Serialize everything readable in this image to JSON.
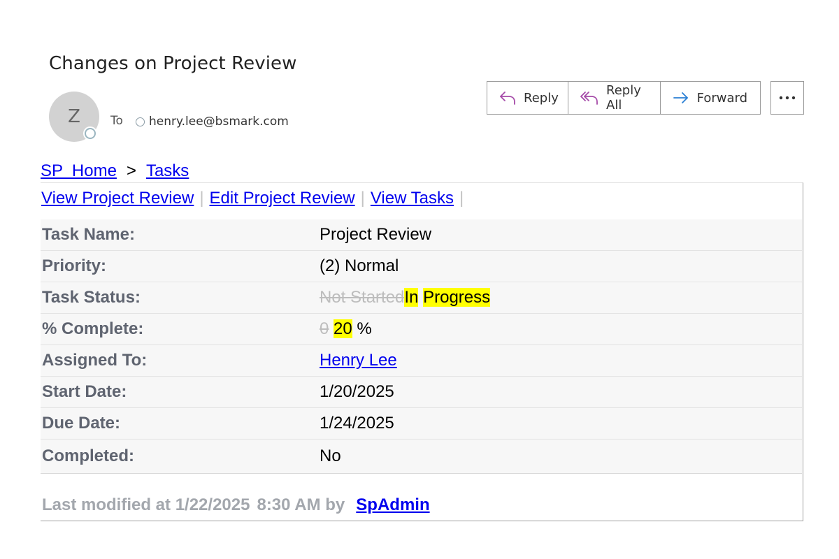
{
  "email": {
    "subject": "Changes on Project Review",
    "avatar_initial": "Z",
    "to_label": "To",
    "recipient": "henry.lee@bsmark.com",
    "actions": {
      "reply": "Reply",
      "reply_all": "Reply All",
      "forward": "Forward"
    }
  },
  "breadcrumb": {
    "home": "SP  Home",
    "separator": ">",
    "current": "Tasks"
  },
  "toolbar": {
    "view_item": "View Project Review",
    "edit_item": "Edit Project Review",
    "view_list": "View Tasks",
    "separator": "|"
  },
  "fields": {
    "task_name": {
      "label": "Task Name:",
      "value": "Project Review"
    },
    "priority": {
      "label": "Priority:",
      "value": "(2) Normal"
    },
    "task_status": {
      "label": "Task Status:",
      "old_value": "Not Started",
      "new_word1": "In",
      "new_word2": "Progress"
    },
    "percent_complete": {
      "label": "% Complete:",
      "old_value": "0",
      "new_value": "20",
      "unit": "%"
    },
    "assigned_to": {
      "label": "Assigned To:",
      "value": "Henry Lee"
    },
    "start_date": {
      "label": "Start Date:",
      "value": "1/20/2025"
    },
    "due_date": {
      "label": "Due Date:",
      "value": "1/24/2025"
    },
    "completed": {
      "label": "Completed:",
      "value": "No"
    }
  },
  "footer": {
    "prefix": "Last modified at 1/22/2025",
    "time": "8:30 AM by",
    "user": "SpAdmin"
  },
  "colors": {
    "link": "#0000ee",
    "highlight": "#ffff00",
    "label": "#5f6470",
    "reply_icon": "#a54aa8",
    "forward_icon": "#2a7fd4"
  }
}
